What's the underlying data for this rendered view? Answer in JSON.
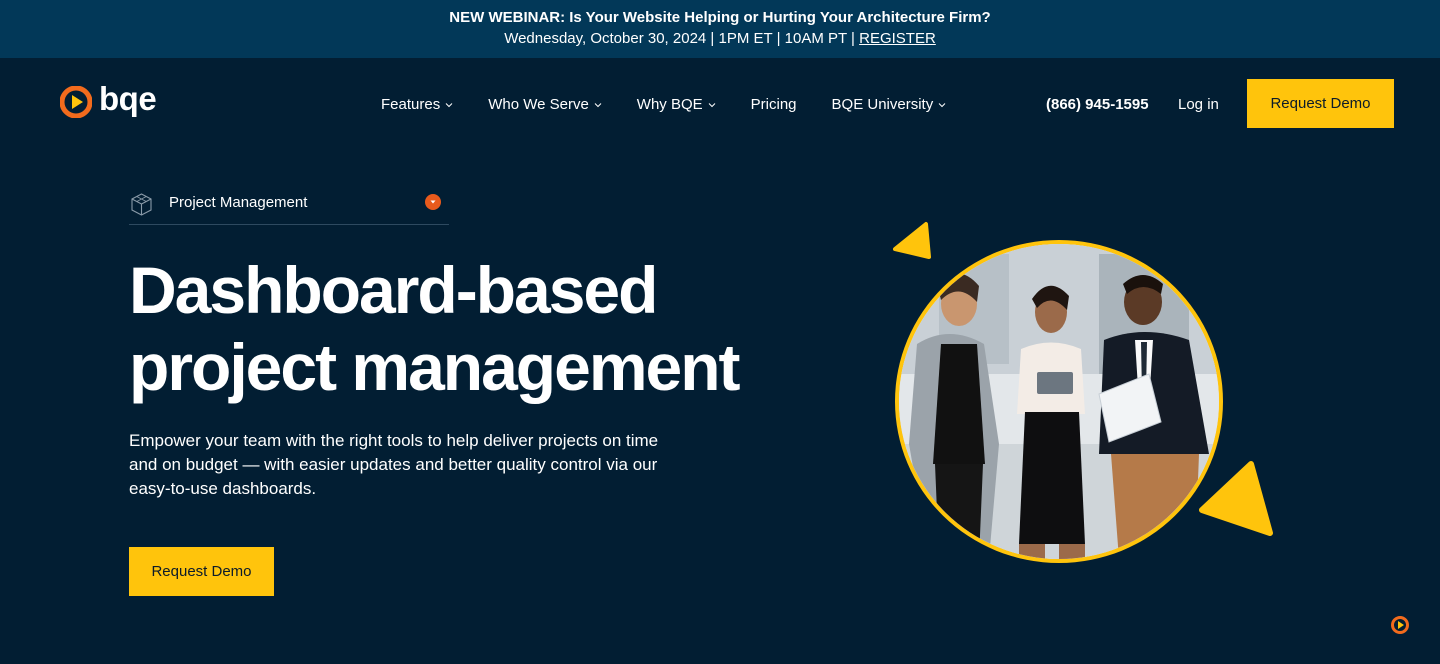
{
  "banner": {
    "headline": "NEW WEBINAR: Is Your Website Helping or Hurting Your Architecture Firm?",
    "details": "Wednesday, October 30, 2024 | 1PM ET | 10AM PT | ",
    "register_label": "REGISTER"
  },
  "header": {
    "logo_text": "bqe",
    "nav": [
      {
        "label": "Features",
        "has_dropdown": true
      },
      {
        "label": "Who We Serve",
        "has_dropdown": true
      },
      {
        "label": "Why BQE",
        "has_dropdown": true
      },
      {
        "label": "Pricing",
        "has_dropdown": false
      },
      {
        "label": "BQE University",
        "has_dropdown": true
      }
    ],
    "phone": "(866) 945-1595",
    "login_label": "Log in",
    "demo_label": "Request Demo"
  },
  "hero": {
    "selector_label": "Project Management",
    "title_line1": "Dashboard-based",
    "title_line2": "project management",
    "description": "Empower your team with the right tools to help deliver projects on time and on budget — with easier updates and better quality control via our easy-to-use dashboards.",
    "cta_label": "Request Demo"
  },
  "colors": {
    "background": "#021e33",
    "banner": "#023858",
    "accent": "#ffc40c",
    "logo_orange": "#f26b1d"
  },
  "icons": {
    "logo": "bqe-play-logo-icon",
    "selector": "cube-icon",
    "toggle": "chevron-down-icon",
    "chat": "chat-launcher-icon"
  }
}
